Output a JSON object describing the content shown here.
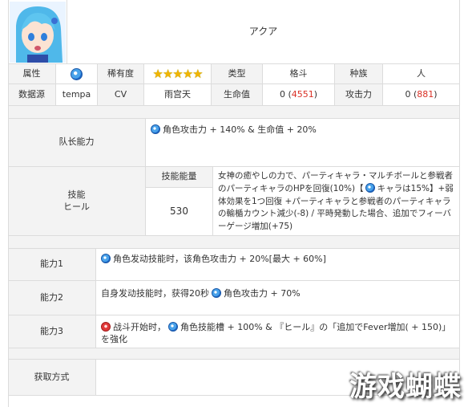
{
  "character": {
    "name": "アクア",
    "element_icon": "blue-orb-icon",
    "rarity_stars": 5,
    "rarity_star_glyph": "★"
  },
  "labels": {
    "attribute": "属性",
    "rarity": "稀有度",
    "type": "类型",
    "race": "种族",
    "data_source": "数据源",
    "cv": "CV",
    "hp": "生命值",
    "attack": "攻击力",
    "leader": "队长能力",
    "skill": "技能\nヒール",
    "skill_energy": "技能能量",
    "ability1": "能力1",
    "ability2": "能力2",
    "ability3": "能力3",
    "acquire": "获取方式"
  },
  "values": {
    "type": "格斗",
    "race": "人",
    "data_source": "tempa",
    "cv": "雨宫天",
    "hp_base": "0 (",
    "hp_max": "4551",
    "attack_base": "0 (",
    "attack_max": "881",
    "close_paren": ")",
    "skill_energy": "530"
  },
  "text": {
    "leader": "角色攻击力 + 140% & 生命值 + 20%",
    "skill_part1": "女神の癒やしの力で、パーティキャラ・マルチボールと参戦者のパーティキャラのHPを回復(10%)【",
    "skill_part2": "キャラは15%】+弱体効果を1つ回復 +パーティキャラと参戦者のパーティキャラの輸楯カウント減少(-8) / 平時発動した場合、追加でフィーバーゲージ増加(+75)",
    "ability1": "角色发动技能时，该角色攻击力 + 20%[最大 + 60%]",
    "ability2_pre": "自身发动技能时，获得20秒",
    "ability2_post": "角色攻击力 + 70%",
    "ability3_pre": "战斗开始时，",
    "ability3_post": "角色技能槽 + 100% & 『ヒール』の「追加でFever増加( + 150)」を強化",
    "acquire": ""
  },
  "watermark": "游戏蝴蝶",
  "colors": {
    "header_bg": "#f3f3f3",
    "border": "#dcdcdc",
    "stat_red": "#d93025",
    "orb_blue": "#2f7fdc"
  }
}
